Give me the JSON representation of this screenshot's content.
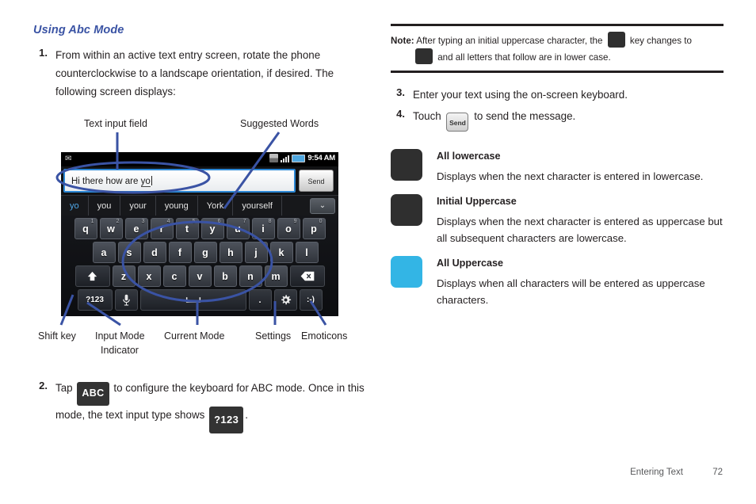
{
  "left": {
    "section_heading": "Using Abc Mode",
    "step1": {
      "num": "1.",
      "text": "From within an active text entry screen, rotate the phone counterclockwise to a landscape orientation, if desired. The following screen displays:"
    },
    "step2": {
      "num": "2.",
      "text_a": "Tap",
      "badge_abc": "ABC",
      "text_b": "to configure the keyboard for ABC mode. Once in this mode, the text input type shows",
      "badge_123": "?123",
      "text_c": "."
    },
    "callouts": {
      "text_input_field": "Text input field",
      "suggested_words": "Suggested Words",
      "shift_key": "Shift key",
      "input_mode_indicator_l1": "Input Mode",
      "input_mode_indicator_l2": "Indicator",
      "current_mode": "Current Mode",
      "settings": "Settings",
      "emoticons": "Emoticons"
    }
  },
  "phone": {
    "statusbar": {
      "mail_icon": "mail-icon",
      "sync_icon": "sync-icon",
      "signal_icon": "signal-bars-icon",
      "battery_icon": "battery-icon",
      "time": "9:54 AM"
    },
    "input": {
      "value": "Hi there how are yo",
      "underlined_part": "yo",
      "send_label": "Send"
    },
    "suggestions": {
      "items": [
        "yo",
        "you",
        "your",
        "young",
        "York",
        "yourself"
      ],
      "active_index": 0,
      "expand_icon": "chevron-down-icon"
    },
    "keyboard": {
      "row1": [
        {
          "label": "q",
          "sup": "1"
        },
        {
          "label": "w",
          "sup": "2"
        },
        {
          "label": "e",
          "sup": "3"
        },
        {
          "label": "r",
          "sup": "4"
        },
        {
          "label": "t",
          "sup": "5"
        },
        {
          "label": "y",
          "sup": "6"
        },
        {
          "label": "u",
          "sup": "7"
        },
        {
          "label": "i",
          "sup": "8"
        },
        {
          "label": "o",
          "sup": "9"
        },
        {
          "label": "p",
          "sup": "0"
        }
      ],
      "row2": [
        "a",
        "s",
        "d",
        "f",
        "g",
        "h",
        "j",
        "k",
        "l"
      ],
      "row3_shift_icon": "shift-arrow-icon",
      "row3": [
        "z",
        "x",
        "c",
        "v",
        "b",
        "n",
        "m"
      ],
      "row3_backspace_icon": "backspace-icon",
      "row4": {
        "mode_label": "?123",
        "mic_icon": "microphone-icon",
        "space_icon": "space-bar-icon",
        "period_label": ".",
        "settings_icon": "gear-icon",
        "emoticon_label": ":-)"
      }
    }
  },
  "right": {
    "note": {
      "label": "Note:",
      "line1_a": "After typing an initial uppercase character, the",
      "icon1": "shift-initial-uppercase-icon",
      "line1_b": "key changes to",
      "icon2": "shift-all-lowercase-icon",
      "line2": "and all letters that follow are in lower case."
    },
    "step3": {
      "num": "3.",
      "text": "Enter your text using the on-screen keyboard."
    },
    "step4": {
      "num": "4.",
      "text_a": "Touch",
      "send_key": "Send",
      "text_b": "to send the message."
    },
    "states": [
      {
        "icon": "shift-all-lowercase-icon",
        "icon_style": "dark-white-arrow",
        "title": "All lowercase",
        "desc": "Displays when the next character is entered in lowercase."
      },
      {
        "icon": "shift-initial-uppercase-icon",
        "icon_style": "dark-cyan-arrow",
        "title": "Initial Uppercase",
        "desc": "Displays when the next character is entered as uppercase but all subsequent characters are lowercase."
      },
      {
        "icon": "shift-all-uppercase-icon",
        "icon_style": "cyan-white-arrow",
        "title": "All Uppercase",
        "desc": "Displays when all characters will be entered as uppercase characters."
      }
    ]
  },
  "footer": {
    "section": "Entering Text",
    "page": "72"
  },
  "colors": {
    "heading_blue": "#3a53a4",
    "callout_blue": "#3a53a4",
    "accent_cyan": "#33b5e5",
    "key_dark": "#2f2f2f",
    "text": "#231f20"
  }
}
